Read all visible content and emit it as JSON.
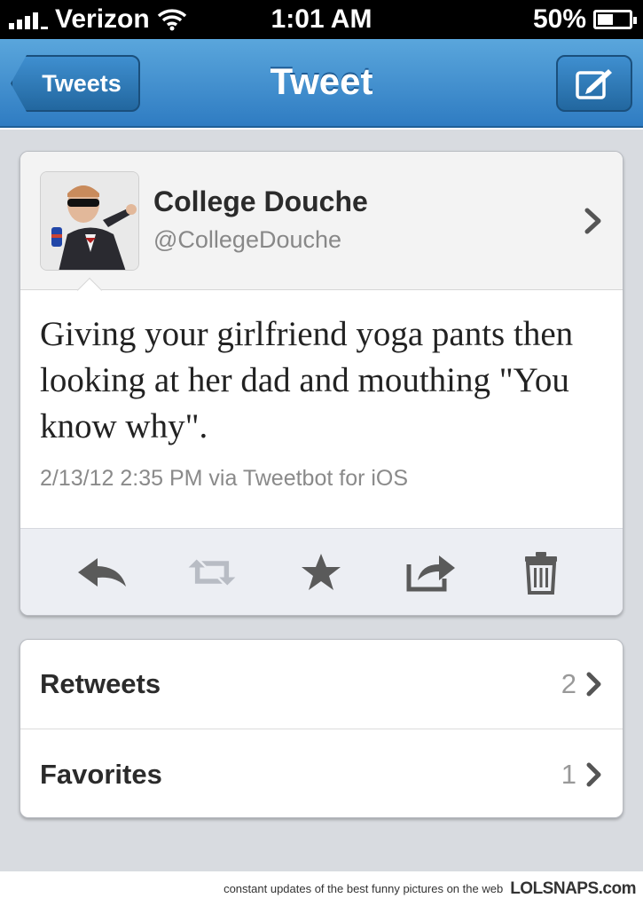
{
  "status_bar": {
    "carrier": "Verizon",
    "time": "1:01 AM",
    "battery": "50%",
    "battery_level": 0.5,
    "icons": [
      "signal-icon",
      "wifi-icon",
      "battery-icon"
    ]
  },
  "nav": {
    "back_label": "Tweets",
    "title": "Tweet",
    "compose_icon": "compose-icon"
  },
  "tweet": {
    "author_name": "College Douche",
    "author_handle": "@CollegeDouche",
    "text": "Giving your girlfriend yoga pants then looking at her dad and mouthing \"You know why\".",
    "meta": "2/13/12 2:35 PM via Tweetbot for iOS",
    "actions": [
      "reply-icon",
      "retweet-icon",
      "favorite-star-icon",
      "share-icon",
      "trash-icon"
    ]
  },
  "stats": [
    {
      "label": "Retweets",
      "count": "2"
    },
    {
      "label": "Favorites",
      "count": "1"
    }
  ],
  "footer": {
    "caption": "constant updates of the best funny pictures on the web",
    "logo": "LOLSNAPS.com"
  },
  "colors": {
    "nav_top": "#5aa6dc",
    "nav_bottom": "#2f7cc2",
    "background": "#d8dbe0",
    "action_icon": "#5a5a5a"
  }
}
